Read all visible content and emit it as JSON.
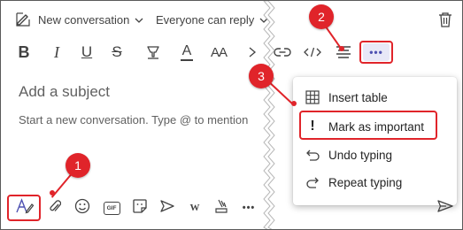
{
  "header": {
    "conversation_type": "New conversation",
    "reply_setting": "Everyone can reply"
  },
  "composer": {
    "subject_placeholder": "Add a subject",
    "body_placeholder": "Start a new conversation. Type @ to mention"
  },
  "toolbar": {
    "icons": [
      "bold-icon",
      "italic-icon",
      "underline-icon",
      "strikethrough-icon",
      "highlight-icon",
      "font-color-icon",
      "font-size-icon",
      "link-icon",
      "code-icon",
      "align-icon",
      "more-options-icon"
    ],
    "bold_glyph": "B",
    "italic_glyph": "I",
    "underline_glyph": "U",
    "strike_glyph": "S",
    "font_color_glyph": "A",
    "font_size_glyph": "AA",
    "more_glyph": "•••"
  },
  "menu": {
    "items": [
      {
        "label": "Insert table",
        "icon": "table-icon"
      },
      {
        "label": "Mark as important",
        "icon": "exclamation-icon"
      },
      {
        "label": "Undo typing",
        "icon": "undo-icon"
      },
      {
        "label": "Repeat typing",
        "icon": "redo-icon"
      }
    ],
    "important_glyph": "!"
  },
  "bottom_toolbar": {
    "icons": [
      "format-icon",
      "attach-icon",
      "emoji-icon",
      "gif-icon",
      "sticker-icon",
      "schedule-meeting-icon",
      "wiki-icon",
      "praise-icon",
      "more-apps-icon",
      "send-icon"
    ],
    "gif_label": "GIF",
    "wiki_label": "W",
    "more_glyph": "•••"
  },
  "annotations": {
    "badge_1": "1",
    "badge_2": "2",
    "badge_3": "3"
  },
  "colors": {
    "callout_red": "#e0242a",
    "more_button_blue": "#4f52b2",
    "text_dark": "#242424",
    "text_gray": "#616161"
  }
}
